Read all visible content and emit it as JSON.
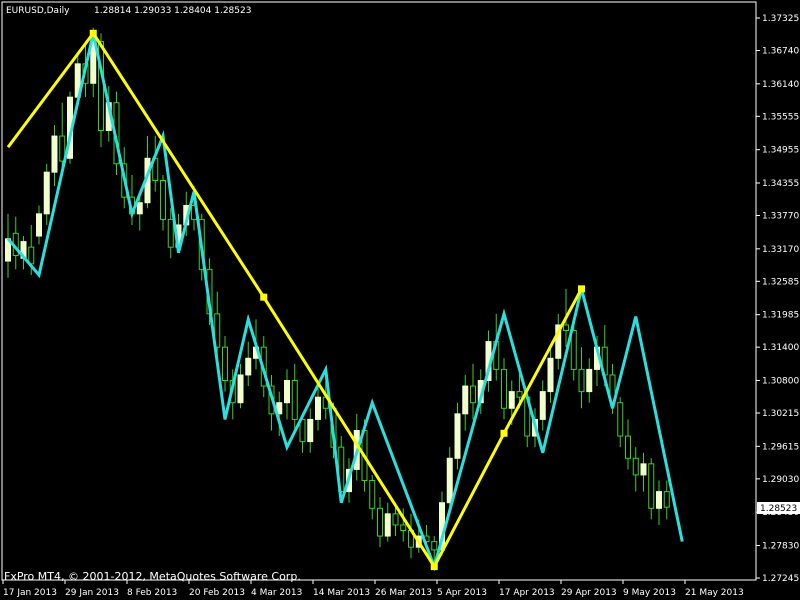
{
  "header": {
    "symbol": "EURUSD,Daily",
    "ohlc": "1.28814 1.29033 1.28404 1.28523"
  },
  "footer": {
    "copyright": "FxPro MT4, © 2001-2012, MetaQuotes Software Corp."
  },
  "colors": {
    "background": "#000000",
    "axis": "#ffffff",
    "bull_candle": "#f0ffcc",
    "bear_candle": "#000000",
    "wick": "#3ccf1e",
    "zigzag_major": "#ffff00",
    "zigzag_minor": "#29e0e0"
  },
  "chart_data": {
    "type": "line",
    "title": "EURUSD,Daily",
    "last_price": "1.28523",
    "ylim": [
      1.27245,
      1.37325
    ],
    "y_ticks": [
      "1.37325",
      "1.36740",
      "1.36140",
      "1.35555",
      "1.34955",
      "1.34355",
      "1.33770",
      "1.33170",
      "1.32585",
      "1.31985",
      "1.31400",
      "1.30800",
      "1.30215",
      "1.29615",
      "1.29030",
      "1.28430",
      "1.27830",
      "1.27245"
    ],
    "x_ticks": [
      "17 Jan 2013",
      "29 Jan 2013",
      "8 Feb 2013",
      "20 Feb 2013",
      "4 Mar 2013",
      "14 Mar 2013",
      "26 Mar 2013",
      "5 Apr 2013",
      "17 Apr 2013",
      "29 Apr 2013",
      "9 May 2013",
      "21 May 2013"
    ],
    "x_tick_index": [
      0,
      8,
      16,
      24,
      32,
      40,
      48,
      56,
      64,
      72,
      80,
      88
    ],
    "candles": [
      {
        "o": 1.3295,
        "h": 1.338,
        "l": 1.3265,
        "c": 1.3335
      },
      {
        "o": 1.3345,
        "h": 1.3375,
        "l": 1.328,
        "c": 1.3305
      },
      {
        "o": 1.33,
        "h": 1.334,
        "l": 1.328,
        "c": 1.333
      },
      {
        "o": 1.332,
        "h": 1.336,
        "l": 1.327,
        "c": 1.329
      },
      {
        "o": 1.334,
        "h": 1.3395,
        "l": 1.3325,
        "c": 1.338
      },
      {
        "o": 1.338,
        "h": 1.347,
        "l": 1.336,
        "c": 1.3455
      },
      {
        "o": 1.3455,
        "h": 1.354,
        "l": 1.343,
        "c": 1.352
      },
      {
        "o": 1.352,
        "h": 1.358,
        "l": 1.346,
        "c": 1.3475
      },
      {
        "o": 1.348,
        "h": 1.36,
        "l": 1.347,
        "c": 1.359
      },
      {
        "o": 1.359,
        "h": 1.367,
        "l": 1.3575,
        "c": 1.365
      },
      {
        "o": 1.365,
        "h": 1.369,
        "l": 1.359,
        "c": 1.3615
      },
      {
        "o": 1.3615,
        "h": 1.3715,
        "l": 1.359,
        "c": 1.369
      },
      {
        "o": 1.369,
        "h": 1.3705,
        "l": 1.35,
        "c": 1.353
      },
      {
        "o": 1.353,
        "h": 1.361,
        "l": 1.351,
        "c": 1.358
      },
      {
        "o": 1.358,
        "h": 1.36,
        "l": 1.345,
        "c": 1.347
      },
      {
        "o": 1.347,
        "h": 1.35,
        "l": 1.339,
        "c": 1.341
      },
      {
        "o": 1.341,
        "h": 1.345,
        "l": 1.336,
        "c": 1.338
      },
      {
        "o": 1.338,
        "h": 1.342,
        "l": 1.335,
        "c": 1.34
      },
      {
        "o": 1.34,
        "h": 1.352,
        "l": 1.339,
        "c": 1.348
      },
      {
        "o": 1.348,
        "h": 1.352,
        "l": 1.342,
        "c": 1.344
      },
      {
        "o": 1.344,
        "h": 1.345,
        "l": 1.335,
        "c": 1.337
      },
      {
        "o": 1.337,
        "h": 1.339,
        "l": 1.33,
        "c": 1.332
      },
      {
        "o": 1.332,
        "h": 1.338,
        "l": 1.331,
        "c": 1.336
      },
      {
        "o": 1.336,
        "h": 1.342,
        "l": 1.334,
        "c": 1.3395
      },
      {
        "o": 1.3395,
        "h": 1.343,
        "l": 1.335,
        "c": 1.337
      },
      {
        "o": 1.337,
        "h": 1.338,
        "l": 1.326,
        "c": 1.328
      },
      {
        "o": 1.328,
        "h": 1.33,
        "l": 1.318,
        "c": 1.32
      },
      {
        "o": 1.32,
        "h": 1.324,
        "l": 1.312,
        "c": 1.314
      },
      {
        "o": 1.314,
        "h": 1.316,
        "l": 1.306,
        "c": 1.308
      },
      {
        "o": 1.308,
        "h": 1.31,
        "l": 1.301,
        "c": 1.304
      },
      {
        "o": 1.304,
        "h": 1.311,
        "l": 1.303,
        "c": 1.309
      },
      {
        "o": 1.309,
        "h": 1.315,
        "l": 1.307,
        "c": 1.312
      },
      {
        "o": 1.312,
        "h": 1.319,
        "l": 1.31,
        "c": 1.314
      },
      {
        "o": 1.314,
        "h": 1.316,
        "l": 1.305,
        "c": 1.307
      },
      {
        "o": 1.307,
        "h": 1.309,
        "l": 1.299,
        "c": 1.302
      },
      {
        "o": 1.302,
        "h": 1.306,
        "l": 1.298,
        "c": 1.304
      },
      {
        "o": 1.304,
        "h": 1.31,
        "l": 1.301,
        "c": 1.308
      },
      {
        "o": 1.308,
        "h": 1.311,
        "l": 1.299,
        "c": 1.301
      },
      {
        "o": 1.301,
        "h": 1.302,
        "l": 1.295,
        "c": 1.297
      },
      {
        "o": 1.297,
        "h": 1.303,
        "l": 1.295,
        "c": 1.301
      },
      {
        "o": 1.301,
        "h": 1.307,
        "l": 1.299,
        "c": 1.305
      },
      {
        "o": 1.305,
        "h": 1.31,
        "l": 1.301,
        "c": 1.303
      },
      {
        "o": 1.303,
        "h": 1.304,
        "l": 1.294,
        "c": 1.296
      },
      {
        "o": 1.296,
        "h": 1.298,
        "l": 1.286,
        "c": 1.288
      },
      {
        "o": 1.288,
        "h": 1.294,
        "l": 1.286,
        "c": 1.292
      },
      {
        "o": 1.292,
        "h": 1.302,
        "l": 1.29,
        "c": 1.299
      },
      {
        "o": 1.299,
        "h": 1.301,
        "l": 1.288,
        "c": 1.29
      },
      {
        "o": 1.29,
        "h": 1.291,
        "l": 1.283,
        "c": 1.285
      },
      {
        "o": 1.285,
        "h": 1.287,
        "l": 1.278,
        "c": 1.28
      },
      {
        "o": 1.28,
        "h": 1.286,
        "l": 1.279,
        "c": 1.284
      },
      {
        "o": 1.284,
        "h": 1.286,
        "l": 1.28,
        "c": 1.282
      },
      {
        "o": 1.282,
        "h": 1.285,
        "l": 1.279,
        "c": 1.281
      },
      {
        "o": 1.281,
        "h": 1.284,
        "l": 1.276,
        "c": 1.278
      },
      {
        "o": 1.278,
        "h": 1.283,
        "l": 1.277,
        "c": 1.28
      },
      {
        "o": 1.28,
        "h": 1.282,
        "l": 1.278,
        "c": 1.279
      },
      {
        "o": 1.279,
        "h": 1.28,
        "l": 1.2745,
        "c": 1.2775
      },
      {
        "o": 1.2775,
        "h": 1.288,
        "l": 1.2765,
        "c": 1.286
      },
      {
        "o": 1.286,
        "h": 1.296,
        "l": 1.284,
        "c": 1.294
      },
      {
        "o": 1.294,
        "h": 1.304,
        "l": 1.292,
        "c": 1.302
      },
      {
        "o": 1.302,
        "h": 1.309,
        "l": 1.299,
        "c": 1.307
      },
      {
        "o": 1.307,
        "h": 1.311,
        "l": 1.301,
        "c": 1.304
      },
      {
        "o": 1.304,
        "h": 1.31,
        "l": 1.302,
        "c": 1.308
      },
      {
        "o": 1.308,
        "h": 1.317,
        "l": 1.306,
        "c": 1.315
      },
      {
        "o": 1.315,
        "h": 1.32,
        "l": 1.308,
        "c": 1.31
      },
      {
        "o": 1.31,
        "h": 1.312,
        "l": 1.301,
        "c": 1.303
      },
      {
        "o": 1.303,
        "h": 1.308,
        "l": 1.3,
        "c": 1.306
      },
      {
        "o": 1.306,
        "h": 1.31,
        "l": 1.303,
        "c": 1.305
      },
      {
        "o": 1.305,
        "h": 1.306,
        "l": 1.296,
        "c": 1.298
      },
      {
        "o": 1.298,
        "h": 1.303,
        "l": 1.296,
        "c": 1.301
      },
      {
        "o": 1.301,
        "h": 1.308,
        "l": 1.299,
        "c": 1.306
      },
      {
        "o": 1.306,
        "h": 1.314,
        "l": 1.304,
        "c": 1.312
      },
      {
        "o": 1.312,
        "h": 1.32,
        "l": 1.31,
        "c": 1.318
      },
      {
        "o": 1.318,
        "h": 1.3245,
        "l": 1.314,
        "c": 1.317
      },
      {
        "o": 1.317,
        "h": 1.318,
        "l": 1.308,
        "c": 1.31
      },
      {
        "o": 1.31,
        "h": 1.314,
        "l": 1.303,
        "c": 1.306
      },
      {
        "o": 1.306,
        "h": 1.312,
        "l": 1.304,
        "c": 1.31
      },
      {
        "o": 1.31,
        "h": 1.316,
        "l": 1.307,
        "c": 1.314
      },
      {
        "o": 1.314,
        "h": 1.318,
        "l": 1.307,
        "c": 1.309
      },
      {
        "o": 1.309,
        "h": 1.311,
        "l": 1.302,
        "c": 1.304
      },
      {
        "o": 1.304,
        "h": 1.305,
        "l": 1.296,
        "c": 1.298
      },
      {
        "o": 1.298,
        "h": 1.301,
        "l": 1.292,
        "c": 1.294
      },
      {
        "o": 1.294,
        "h": 1.296,
        "l": 1.288,
        "c": 1.291
      },
      {
        "o": 1.291,
        "h": 1.295,
        "l": 1.288,
        "c": 1.293
      },
      {
        "o": 1.293,
        "h": 1.294,
        "l": 1.283,
        "c": 1.285
      },
      {
        "o": 1.285,
        "h": 1.29,
        "l": 1.282,
        "c": 1.288
      },
      {
        "o": 1.288,
        "h": 1.29,
        "l": 1.283,
        "c": 1.2852
      }
    ],
    "series": [
      {
        "name": "",
        "color": "#ffff00",
        "points": [
          [
            0,
            1.35
          ],
          [
            11,
            1.3705
          ],
          [
            33,
            1.323
          ],
          [
            55,
            1.2745
          ],
          [
            64,
            1.2985
          ],
          [
            74,
            1.3245
          ]
        ]
      },
      {
        "name": "",
        "color": "#29e0e0",
        "points": [
          [
            0,
            1.3335
          ],
          [
            4,
            1.327
          ],
          [
            11,
            1.3705
          ],
          [
            16,
            1.338
          ],
          [
            20,
            1.352
          ],
          [
            22,
            1.331
          ],
          [
            24,
            1.342
          ],
          [
            28,
            1.301
          ],
          [
            31,
            1.319
          ],
          [
            36,
            1.296
          ],
          [
            41,
            1.31
          ],
          [
            43,
            1.286
          ],
          [
            47,
            1.304
          ],
          [
            55,
            1.2745
          ],
          [
            64,
            1.32
          ],
          [
            69,
            1.295
          ],
          [
            74,
            1.3245
          ],
          [
            78,
            1.303
          ],
          [
            81,
            1.3195
          ],
          [
            87,
            1.279
          ]
        ]
      }
    ],
    "markers": [
      {
        "series": 0,
        "points": [
          [
            11,
            1.3705
          ],
          [
            33,
            1.323
          ],
          [
            55,
            1.2745
          ],
          [
            64,
            1.2985
          ],
          [
            74,
            1.3245
          ]
        ]
      }
    ]
  }
}
